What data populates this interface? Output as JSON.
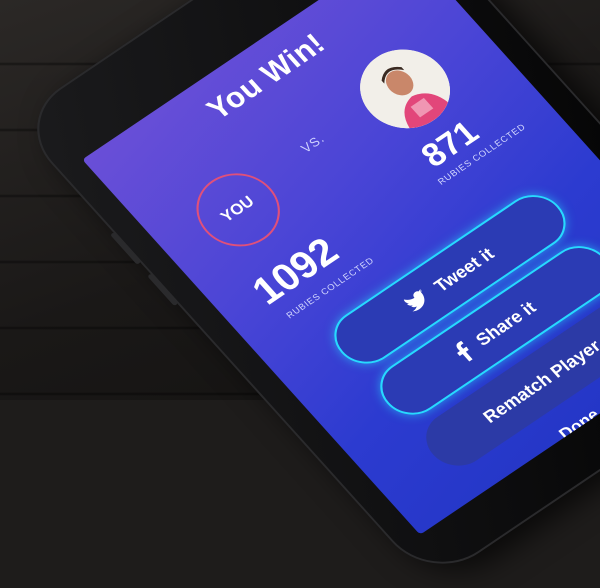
{
  "result": {
    "title": "You Win!"
  },
  "players": {
    "you": {
      "label": "YOU",
      "score": "1092",
      "unit": "RUBIES COLLECTED"
    },
    "vs": "VS.",
    "opponent": {
      "score": "871",
      "unit": "RUBIES COLLECTED"
    }
  },
  "actions": {
    "tweet": "Tweet it",
    "share": "Share it",
    "rematch": "Rematch Player",
    "done": "Done"
  },
  "colors": {
    "accent_glow": "#27d9ff",
    "you_ring": "#e0507a",
    "screen_top": "#6a4fd7",
    "screen_bottom": "#2235c4"
  },
  "icons": {
    "tweet": "twitter-icon",
    "share": "facebook-icon"
  }
}
